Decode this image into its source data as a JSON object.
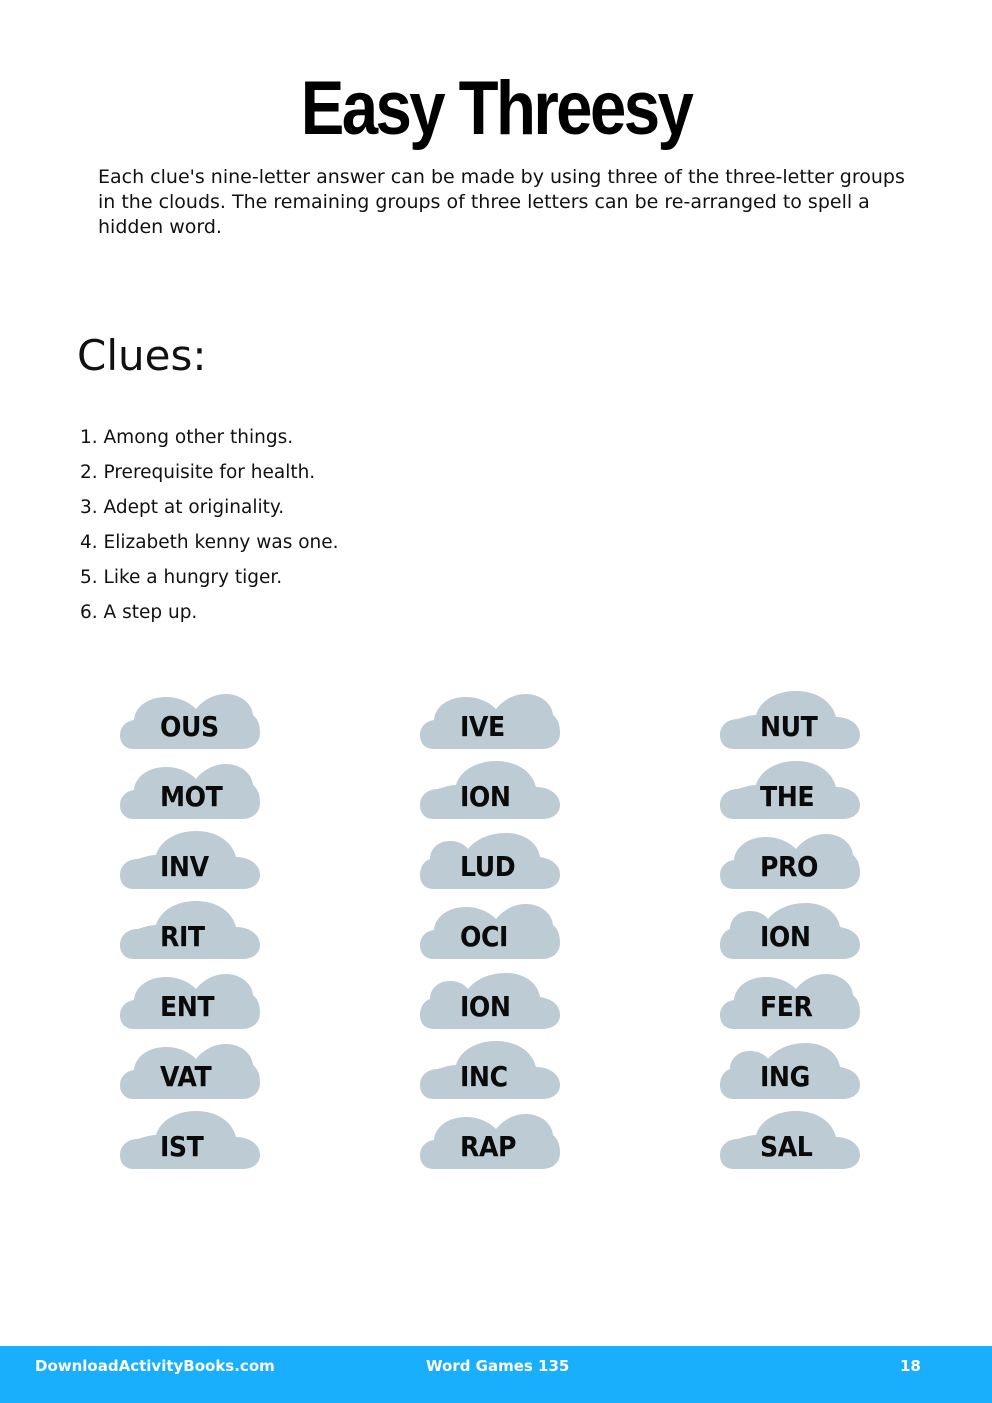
{
  "page": {
    "title": "Easy Threesy",
    "intro": "Each clue's nine-letter answer can be made by using three of the three-letter groups in the clouds. The remaining groups of three letters can be re-arranged to spell a hidden word."
  },
  "clues": {
    "heading": "Clues:",
    "items": [
      "1. Among other things.",
      "2. Prerequisite for health.",
      "3. Adept at originality.",
      "4. Elizabeth kenny was one.",
      "5. Like a hungry tiger.",
      "6. A step up."
    ]
  },
  "clouds": {
    "color": "#bccbd4",
    "columns": [
      [
        {
          "text": "OUS",
          "shape": "a"
        },
        {
          "text": "MOT",
          "shape": "a"
        },
        {
          "text": "INV",
          "shape": "b"
        },
        {
          "text": "RIT",
          "shape": "b"
        },
        {
          "text": "ENT",
          "shape": "a"
        },
        {
          "text": "VAT",
          "shape": "a"
        },
        {
          "text": "IST",
          "shape": "b"
        }
      ],
      [
        {
          "text": "IVE",
          "shape": "a"
        },
        {
          "text": "ION",
          "shape": "b"
        },
        {
          "text": "LUD",
          "shape": "c"
        },
        {
          "text": "OCI",
          "shape": "a"
        },
        {
          "text": "ION",
          "shape": "c"
        },
        {
          "text": "INC",
          "shape": "b"
        },
        {
          "text": "RAP",
          "shape": "a"
        }
      ],
      [
        {
          "text": "NUT",
          "shape": "b"
        },
        {
          "text": "THE",
          "shape": "b"
        },
        {
          "text": "PRO",
          "shape": "a"
        },
        {
          "text": "ION",
          "shape": "c"
        },
        {
          "text": "FER",
          "shape": "a"
        },
        {
          "text": "ING",
          "shape": "c"
        },
        {
          "text": "SAL",
          "shape": "b"
        }
      ]
    ]
  },
  "footer": {
    "site": "DownloadActivityBooks.com",
    "book": "Word Games 135",
    "page_number": "18",
    "color": "#1aaffc"
  }
}
